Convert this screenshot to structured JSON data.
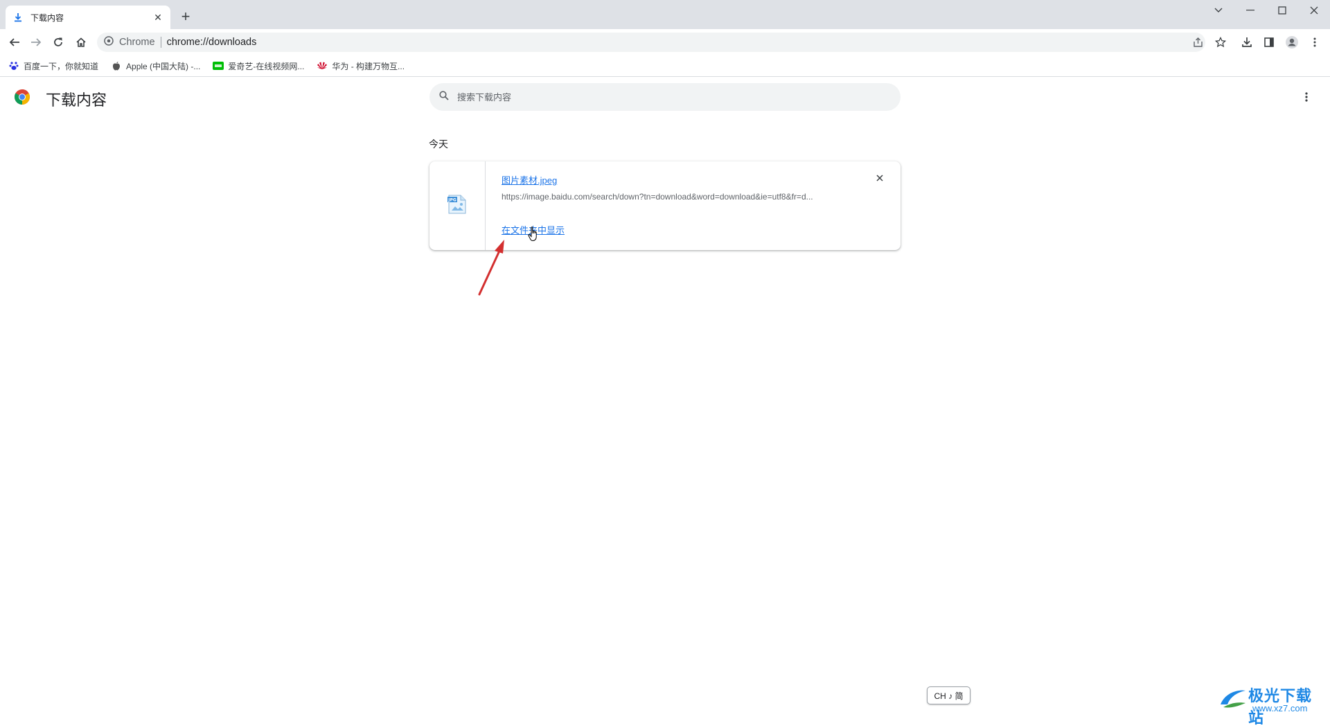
{
  "tab": {
    "title": "下载内容",
    "close": "✕"
  },
  "new_tab": "+",
  "omnibox": {
    "origin": "Chrome",
    "url": "chrome://downloads"
  },
  "bookmarks": [
    {
      "label": "百度一下，你就知道",
      "icon": "baidu-icon"
    },
    {
      "label": "Apple (中国大陆) -...",
      "icon": "apple-icon"
    },
    {
      "label": "爱奇艺-在线视频网...",
      "icon": "iqiyi-icon"
    },
    {
      "label": "华为 - 构建万物互...",
      "icon": "huawei-icon"
    }
  ],
  "page": {
    "title": "下载内容",
    "search_placeholder": "搜索下载内容",
    "section": "今天"
  },
  "download": {
    "file_name": "图片素材.jpeg",
    "url": "https://image.baidu.com/search/down?tn=download&word=download&ie=utf8&fr=d...",
    "show_in_folder": "在文件夹中显示",
    "file_type_badge": "JPG"
  },
  "ime": {
    "label": "CH ♪ 简"
  },
  "watermark": {
    "title": "极光下载站",
    "url": "www.xz7.com"
  },
  "colors": {
    "accent": "#1a73e8",
    "tabstrip": "#dee1e6",
    "arrow": "#d32f2f"
  }
}
